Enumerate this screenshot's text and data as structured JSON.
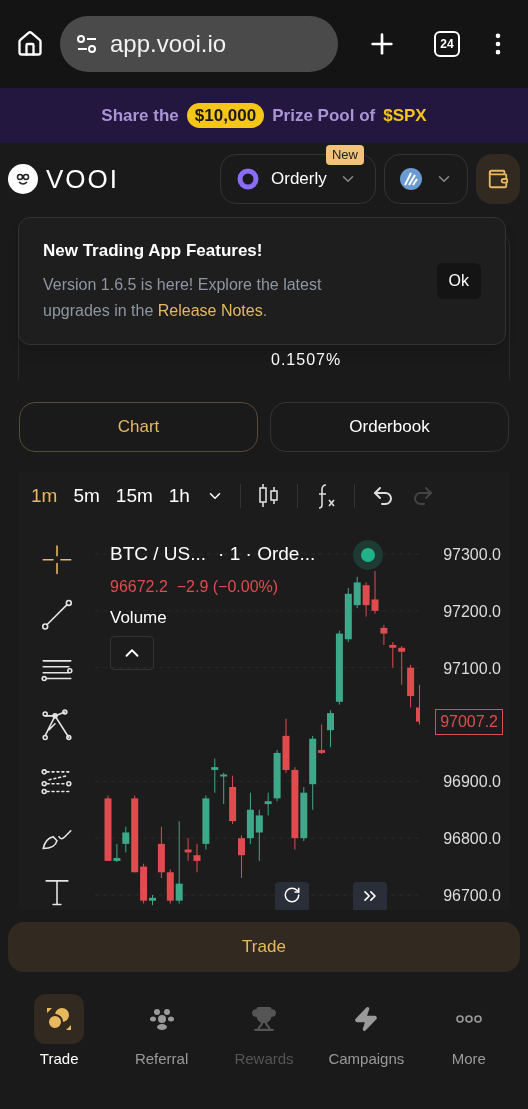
{
  "browser": {
    "url": "app.vooi.io",
    "tab_count": "24"
  },
  "banner": {
    "lead": "Share the",
    "amount": "$10,000",
    "middle": "Prize Pool of",
    "token": "$SPX"
  },
  "header": {
    "brand": "VOOI",
    "network": {
      "label": "Orderly",
      "badge": "New"
    }
  },
  "popup": {
    "title": "New Trading App Features!",
    "body": "Version 1.6.5 is here! Explore the latest upgrades in the",
    "link": "Release Notes",
    "body_end": ".",
    "button": "Ok"
  },
  "market": {
    "funding_value": "0.1507%"
  },
  "view_tabs": [
    {
      "label": "Chart",
      "selected": true
    },
    {
      "label": "Orderbook",
      "selected": false
    }
  ],
  "timeframes": [
    {
      "label": "1m",
      "selected": true
    },
    {
      "label": "5m",
      "selected": false
    },
    {
      "label": "15m",
      "selected": false
    },
    {
      "label": "1h",
      "selected": false
    }
  ],
  "chart": {
    "symbol": "BTC / US...",
    "interval": "· 1 · Orde...",
    "quote": "96672.2  −2.9 (−0.00%)",
    "volume_label": "Volume",
    "last_price": "97007.2",
    "chart_data": {
      "type": "candlestick",
      "ohlc": [
        [
          96870,
          96875,
          96760,
          96760
        ],
        [
          96760,
          96790,
          96758,
          96765
        ],
        [
          96790,
          96820,
          96775,
          96810
        ],
        [
          96870,
          96875,
          96740,
          96740
        ],
        [
          96750,
          96755,
          96685,
          96690
        ],
        [
          96690,
          96700,
          96682,
          96695
        ],
        [
          96790,
          96820,
          96730,
          96740
        ],
        [
          96740,
          96745,
          96685,
          96690
        ],
        [
          96690,
          96830,
          96685,
          96720
        ],
        [
          96780,
          96800,
          96760,
          96775
        ],
        [
          96770,
          96790,
          96740,
          96760
        ],
        [
          96790,
          96875,
          96780,
          96870
        ],
        [
          96920,
          96940,
          96880,
          96925
        ],
        [
          96910,
          96915,
          96860,
          96912
        ],
        [
          96890,
          96910,
          96825,
          96830
        ],
        [
          96800,
          96805,
          96730,
          96770
        ],
        [
          96800,
          96880,
          96790,
          96850
        ],
        [
          96810,
          96850,
          96760,
          96840
        ],
        [
          96860,
          96880,
          96840,
          96865
        ],
        [
          96870,
          96955,
          96865,
          96950
        ],
        [
          96980,
          97010,
          96915,
          96920
        ],
        [
          96920,
          96925,
          96780,
          96800
        ],
        [
          96800,
          96890,
          96795,
          96880
        ],
        [
          96895,
          96980,
          96850,
          96975
        ],
        [
          96955,
          97000,
          96948,
          96950
        ],
        [
          96990,
          97025,
          96960,
          97020
        ],
        [
          97040,
          97165,
          97035,
          97160
        ],
        [
          97150,
          97240,
          97145,
          97230
        ],
        [
          97210,
          97260,
          97205,
          97250
        ],
        [
          97245,
          97250,
          97190,
          97210
        ],
        [
          97220,
          97270,
          97195,
          97200
        ],
        [
          97170,
          97175,
          97140,
          97160
        ],
        [
          97140,
          97145,
          97100,
          97135
        ],
        [
          97135,
          97138,
          97070,
          97128
        ],
        [
          97100,
          97105,
          97030,
          97050
        ],
        [
          97030,
          97070,
          97000,
          97005
        ]
      ],
      "grid": true,
      "ylim": [
        96700,
        97300
      ],
      "yticks": [
        {
          "value": 97300,
          "label": "97300.0"
        },
        {
          "value": 97200,
          "label": "97200.0"
        },
        {
          "value": 97100,
          "label": "97100.0"
        },
        {
          "value": 96900,
          "label": "96900.0"
        },
        {
          "value": 96800,
          "label": "96800.0"
        },
        {
          "value": 96700,
          "label": "96700.0"
        }
      ]
    }
  },
  "trade_button": "Trade",
  "nav": [
    {
      "label": "Trade",
      "selected": true,
      "disabled": false,
      "kind": "trade"
    },
    {
      "label": "Referral",
      "selected": false,
      "disabled": false,
      "kind": "referral"
    },
    {
      "label": "Rewards",
      "selected": false,
      "disabled": true,
      "kind": "rewards"
    },
    {
      "label": "Campaigns",
      "selected": false,
      "disabled": false,
      "kind": "campaigns"
    },
    {
      "label": "More",
      "selected": false,
      "disabled": false,
      "kind": "more"
    }
  ]
}
